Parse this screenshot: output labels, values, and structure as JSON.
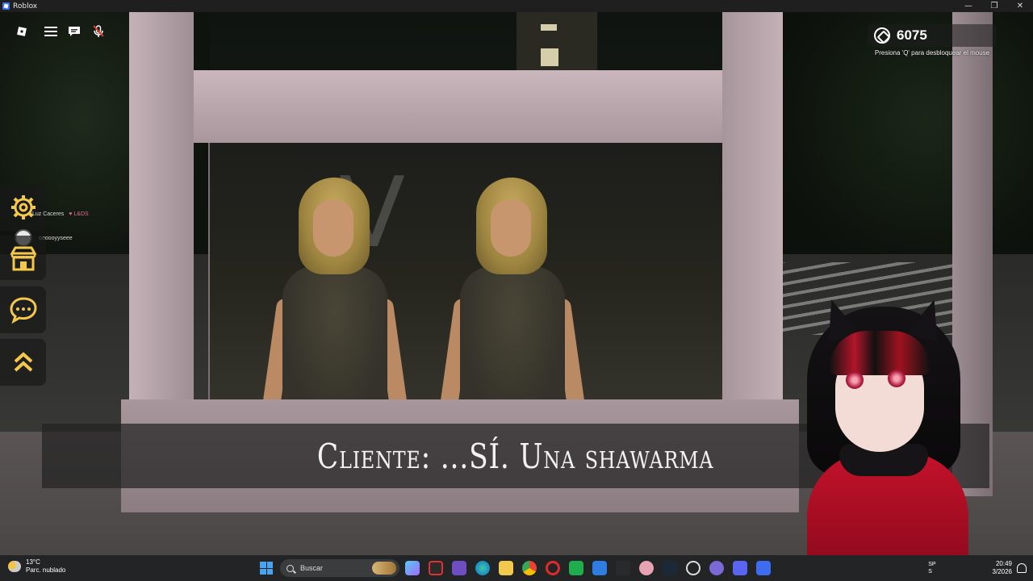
{
  "window": {
    "title": "Roblox",
    "controls": [
      "—",
      "❐",
      "✕"
    ]
  },
  "game": {
    "robux_amount": "6075",
    "mouse_hint": "Presiona 'Q' para desbloquear el mouse",
    "subtitle": "Cliente: ...SÍ. Una shawarma",
    "player_list": [
      {
        "name": "Luz Caceres",
        "extra": "♥ L&DS"
      },
      {
        "name": "oooooyyseee",
        "extra": ""
      }
    ],
    "side_menu": [
      "settings",
      "shop",
      "chat",
      "expand"
    ]
  },
  "taskbar": {
    "weather_temp": "13°C",
    "weather_desc": "Parc. nublado",
    "search_placeholder": "Buscar",
    "lang_line1": "SP",
    "lang_line2": "S",
    "time": "20:49",
    "date": "3/2026"
  },
  "colors": {
    "accent_yellow": "#f3c84b",
    "frame": "#b6a3a9",
    "taskbar": "#222426"
  }
}
